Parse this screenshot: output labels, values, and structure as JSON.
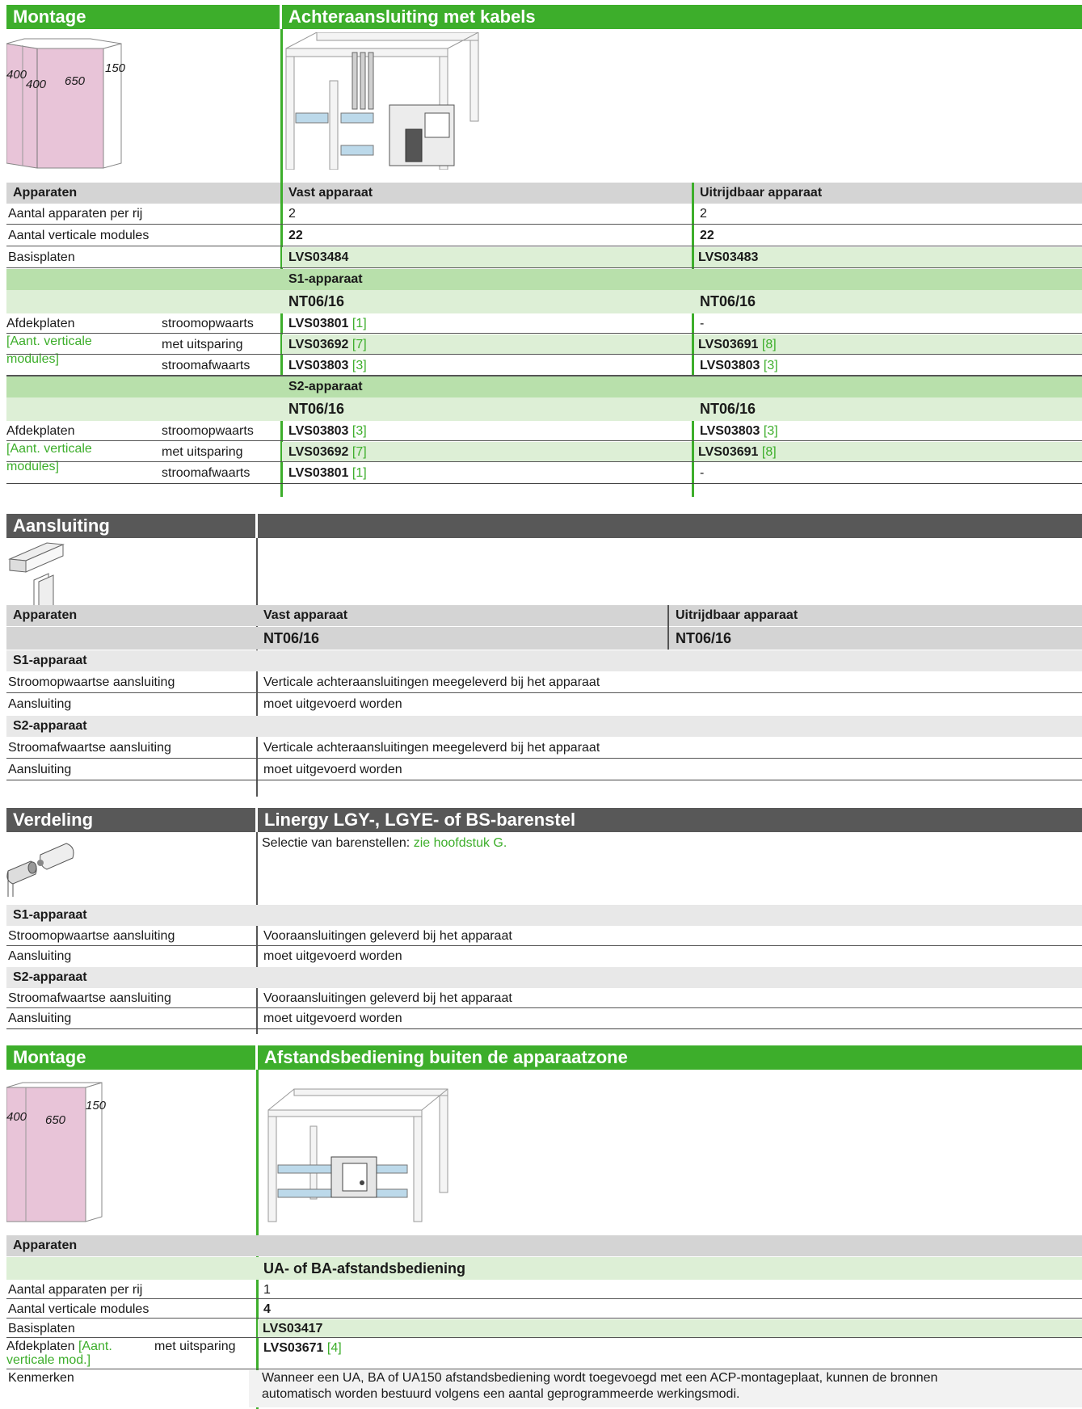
{
  "s1": {
    "hdr_left": "Montage",
    "hdr_right": "Achteraansluiting met kabels",
    "dims": [
      "400",
      "400",
      "650",
      "150"
    ],
    "col_head": [
      "Apparaten",
      "Vast apparaat",
      "Uitrijdbaar apparaat"
    ],
    "rows": [
      {
        "label": "Aantal apparaten per rij",
        "v1": "2",
        "v2": "2"
      },
      {
        "label": "Aantal verticale modules",
        "v1": "22",
        "v2": "22"
      },
      {
        "label": "Basisplaten",
        "v1": "LVS03484",
        "v2": "LVS03483"
      }
    ],
    "s1_title": "S1-apparaat",
    "s1_model": [
      "NT06/16",
      "NT06/16"
    ],
    "afdek_label": "Afdekplaten",
    "afdek_sub": "[Aant. verticale modules]",
    "s1_rows": [
      {
        "sub": "stroomopwaarts",
        "v1": "LVS03801",
        "r1": "[1]",
        "v2": "-",
        "r2": ""
      },
      {
        "sub": "met uitsparing",
        "v1": "LVS03692",
        "r1": "[7]",
        "v2": "LVS03691",
        "r2": "[8]"
      },
      {
        "sub": "stroomafwaarts",
        "v1": "LVS03803",
        "r1": "[3]",
        "v2": "LVS03803",
        "r2": "[3]"
      }
    ],
    "s2_title": "S2-apparaat",
    "s2_model": [
      "NT06/16",
      "NT06/16"
    ],
    "s2_rows": [
      {
        "sub": "stroomopwaarts",
        "v1": "LVS03803",
        "r1": "[3]",
        "v2": "LVS03803",
        "r2": "[3]"
      },
      {
        "sub": "met uitsparing",
        "v1": "LVS03692",
        "r1": "[7]",
        "v2": "LVS03691",
        "r2": "[8]"
      },
      {
        "sub": "stroomafwaarts",
        "v1": "LVS03801",
        "r1": "[1]",
        "v2": "-",
        "r2": ""
      }
    ]
  },
  "s2": {
    "hdr_left": "Aansluiting",
    "col_head": [
      "Apparaten",
      "Vast apparaat",
      "Uitrijdbaar apparaat"
    ],
    "models": [
      "NT06/16",
      "NT06/16"
    ],
    "s1_title": "S1-apparaat",
    "rows_a": [
      {
        "label": "Stroomopwaartse aansluiting",
        "value": "Verticale achteraansluitingen meegeleverd bij het apparaat"
      },
      {
        "label": "Aansluiting",
        "value": "moet uitgevoerd worden"
      }
    ],
    "s2_title": "S2-apparaat",
    "rows_b": [
      {
        "label": "Stroomafwaartse aansluiting",
        "value": "Verticale achteraansluitingen meegeleverd bij het apparaat"
      },
      {
        "label": "Aansluiting",
        "value": "moet uitgevoerd worden"
      }
    ]
  },
  "s3": {
    "hdr_left": "Verdeling",
    "hdr_right": "Linergy LGY-, LGYE- of BS-barenstel",
    "selectie": "Selectie van barenstellen:",
    "link": "zie hoofdstuk G.",
    "s1_title": "S1-apparaat",
    "rows_a": [
      {
        "label": "Stroomopwaartse aansluiting",
        "value": "Vooraansluitingen geleverd bij het apparaat"
      },
      {
        "label": "Aansluiting",
        "value": "moet uitgevoerd worden"
      }
    ],
    "s2_title": "S2-apparaat",
    "rows_b": [
      {
        "label": "Stroomafwaartse aansluiting",
        "value": "Vooraansluitingen geleverd bij het apparaat"
      },
      {
        "label": "Aansluiting",
        "value": "moet uitgevoerd worden"
      }
    ]
  },
  "s4": {
    "hdr_left": "Montage",
    "hdr_right": "Afstandsbediening buiten de apparaatzone",
    "dims": [
      "400",
      "650",
      "150"
    ],
    "apparaten": "Apparaten",
    "model": "UA- of BA-afstandsbediening",
    "rows": [
      {
        "label": "Aantal apparaten per rij",
        "value": "1"
      },
      {
        "label": "Aantal verticale modules",
        "value": "4"
      },
      {
        "label": "Basisplaten",
        "value": "LVS03417"
      }
    ],
    "afdek_label": "Afdekplaten",
    "afdek_ref": "[Aant.",
    "afdek_ref2": "verticale mod.]",
    "afdek_sub": "met uitsparing",
    "afdek_value": "LVS03671",
    "afdek_r": "[4]",
    "kenmerken_label": "Kenmerken",
    "kenmerken_1": "Wanneer een UA, BA of UA150 afstandsbediening wordt toegevoegd met een ACP-montageplaat, kunnen de bronnen",
    "kenmerken_2": "automatisch worden bestuurd volgens een aantal geprogrammeerde werkingsmodi."
  }
}
